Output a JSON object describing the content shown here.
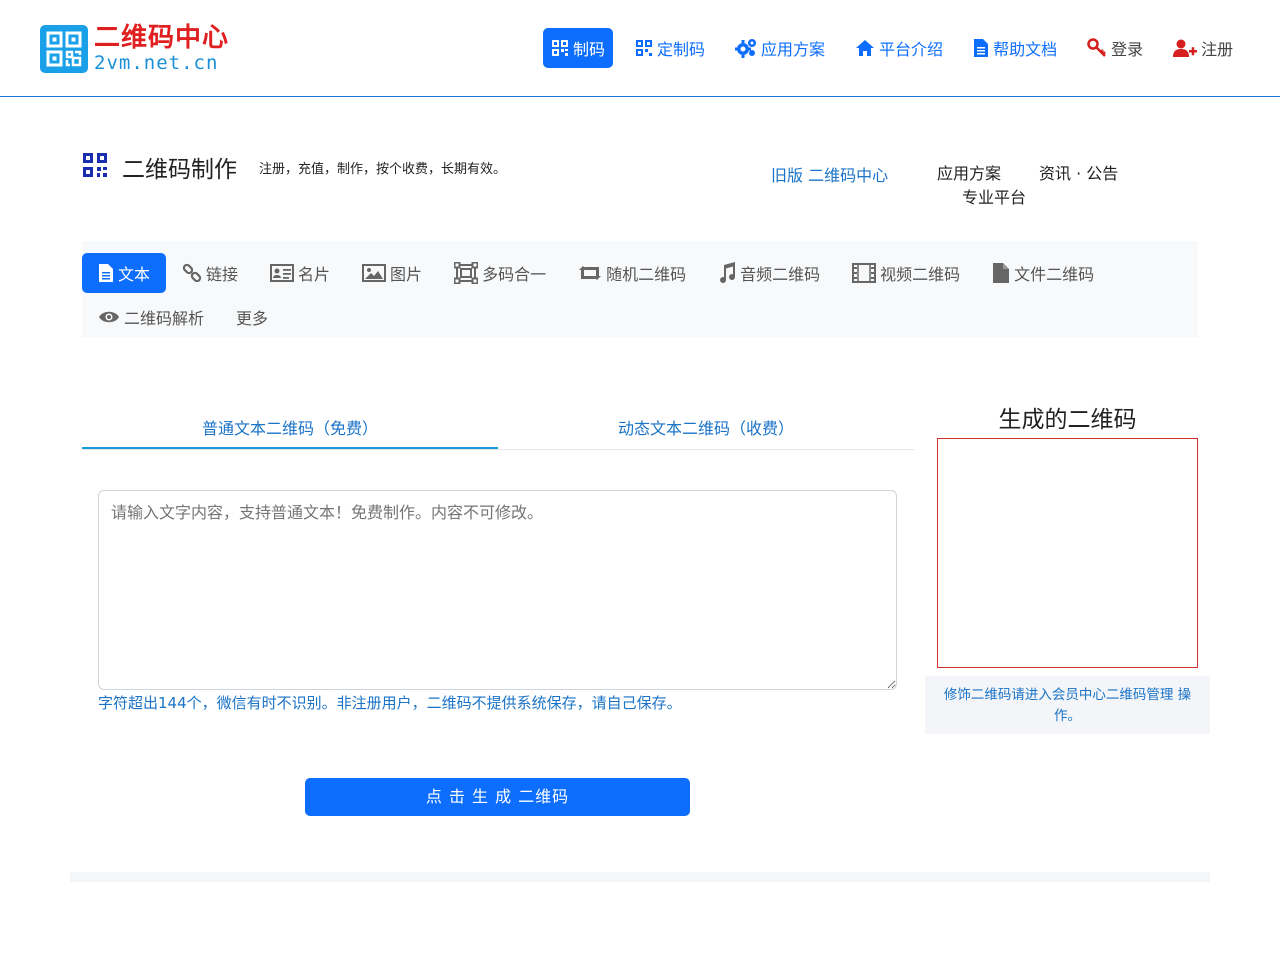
{
  "brand": {
    "title": "二维码中心",
    "domain": "2vm.net.cn",
    "logo_icon": "qr-logo-icon",
    "title_color": "#e02020",
    "domain_color": "#1a8fd8"
  },
  "nav": [
    {
      "label": "制码",
      "icon": "qr-icon",
      "active": true
    },
    {
      "label": "定制码",
      "icon": "qr-icon"
    },
    {
      "label": "应用方案",
      "icon": "gears-icon"
    },
    {
      "label": "平台介绍",
      "icon": "home-icon"
    },
    {
      "label": "帮助文档",
      "icon": "document-icon"
    },
    {
      "label": "登录",
      "icon": "key-icon"
    },
    {
      "label": "注册",
      "icon": "user-plus-icon"
    }
  ],
  "page": {
    "title": "二维码制作",
    "subtitle": "注册，充值，制作，按个收费，长期有效。",
    "old_version": "旧版  二维码中心",
    "links": [
      "应用方案",
      "资讯 · 公告",
      "专业平台"
    ]
  },
  "tabs": [
    {
      "label": "文本",
      "icon": "file-text-icon",
      "active": true
    },
    {
      "label": "链接",
      "icon": "link-icon"
    },
    {
      "label": "名片",
      "icon": "id-card-icon"
    },
    {
      "label": "图片",
      "icon": "image-icon"
    },
    {
      "label": "多码合一",
      "icon": "multi-code-icon"
    },
    {
      "label": "随机二维码",
      "icon": "retweet-icon"
    },
    {
      "label": "音频二维码",
      "icon": "music-icon"
    },
    {
      "label": "视频二维码",
      "icon": "film-icon"
    },
    {
      "label": "文件二维码",
      "icon": "file-icon"
    },
    {
      "label": "二维码解析",
      "icon": "eye-icon"
    },
    {
      "label": "更多",
      "icon": ""
    }
  ],
  "subtabs": [
    {
      "label": "普通文本二维码（免费）",
      "active": true
    },
    {
      "label": "动态文本二维码（收费）"
    }
  ],
  "form": {
    "text_placeholder": "请输入文字内容，支持普通文本！免费制作。内容不可修改。",
    "text_value": "",
    "hint": "字符超出144个，微信有时不识别。非注册用户，二维码不提供系统保存，请自己保存。",
    "submit_label": "点 击 生 成 二维码"
  },
  "result": {
    "title": "生成的二维码",
    "note": "修饰二维码请进入会员中心二维码管理 操作。"
  },
  "colors": {
    "primary": "#0d6efd",
    "link": "#1a73c7",
    "qr_border": "#d32f2f"
  }
}
